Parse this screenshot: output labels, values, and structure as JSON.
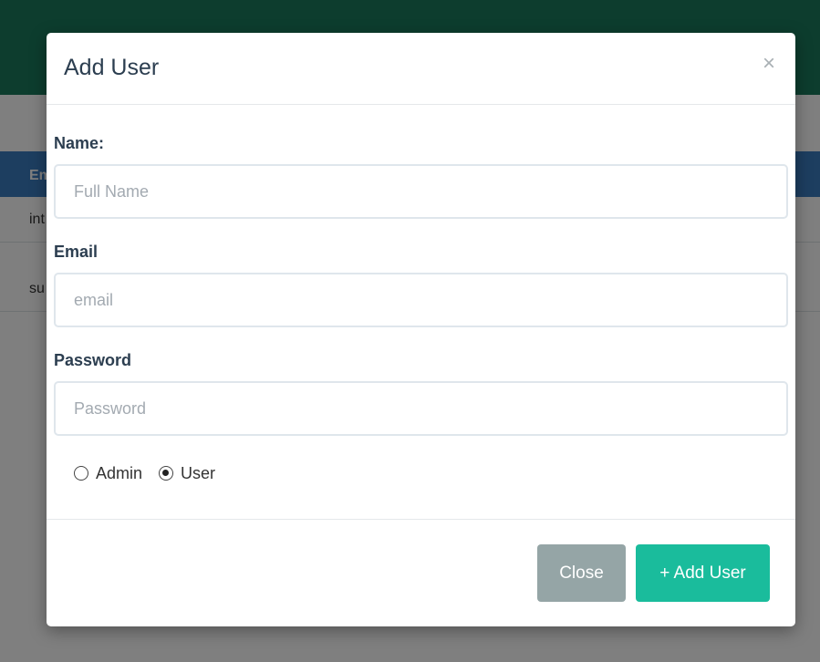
{
  "background": {
    "table_header_text": "Em",
    "row1_text": "int",
    "row2_text": "su"
  },
  "modal": {
    "title": "Add User",
    "close_glyph": "×",
    "fields": {
      "name": {
        "label": "Name:",
        "placeholder": "Full Name",
        "value": ""
      },
      "email": {
        "label": "Email",
        "placeholder": "email",
        "value": ""
      },
      "password": {
        "label": "Password",
        "placeholder": "Password",
        "value": ""
      }
    },
    "role": {
      "options": [
        "Admin",
        "User"
      ],
      "selected": "User"
    },
    "footer": {
      "close_label": "Close",
      "add_label": "+ Add User"
    }
  },
  "colors": {
    "navbar": "#1a7a5c",
    "table_header": "#3b7cc1",
    "primary_button": "#1abc9c",
    "secondary_button": "#95a5a6",
    "title_text": "#2c3e50"
  }
}
